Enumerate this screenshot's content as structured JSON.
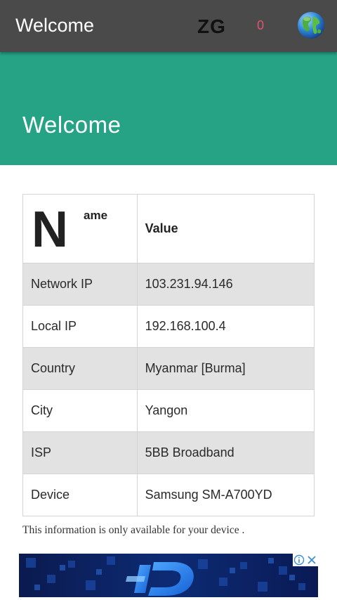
{
  "toolbar": {
    "title": "Welcome",
    "zg_label": "ZG",
    "counter": "0",
    "globe_icon": "globe-icon"
  },
  "hero": {
    "title": "Welcome"
  },
  "table": {
    "name_dropcap": "N",
    "name_rest": "ame",
    "value_header": "Value",
    "rows": [
      {
        "label": "Network IP",
        "value": "103.231.94.146"
      },
      {
        "label": "Local IP",
        "value": "192.168.100.4"
      },
      {
        "label": "Country",
        "value": "Myanmar [Burma]"
      },
      {
        "label": "City",
        "value": "Yangon"
      },
      {
        "label": "ISP",
        "value": "5BB Broadband"
      },
      {
        "label": "Device",
        "value": "Samsung SM-A700YD"
      }
    ]
  },
  "note": "This information is only available for your device .",
  "ad": {
    "info_icon": "info-icon",
    "close_icon": "close-icon"
  },
  "colors": {
    "toolbar": "#4a4a4a",
    "hero": "#26a385",
    "counter": "#e0556e",
    "row_shade": "#e2e2e2"
  }
}
